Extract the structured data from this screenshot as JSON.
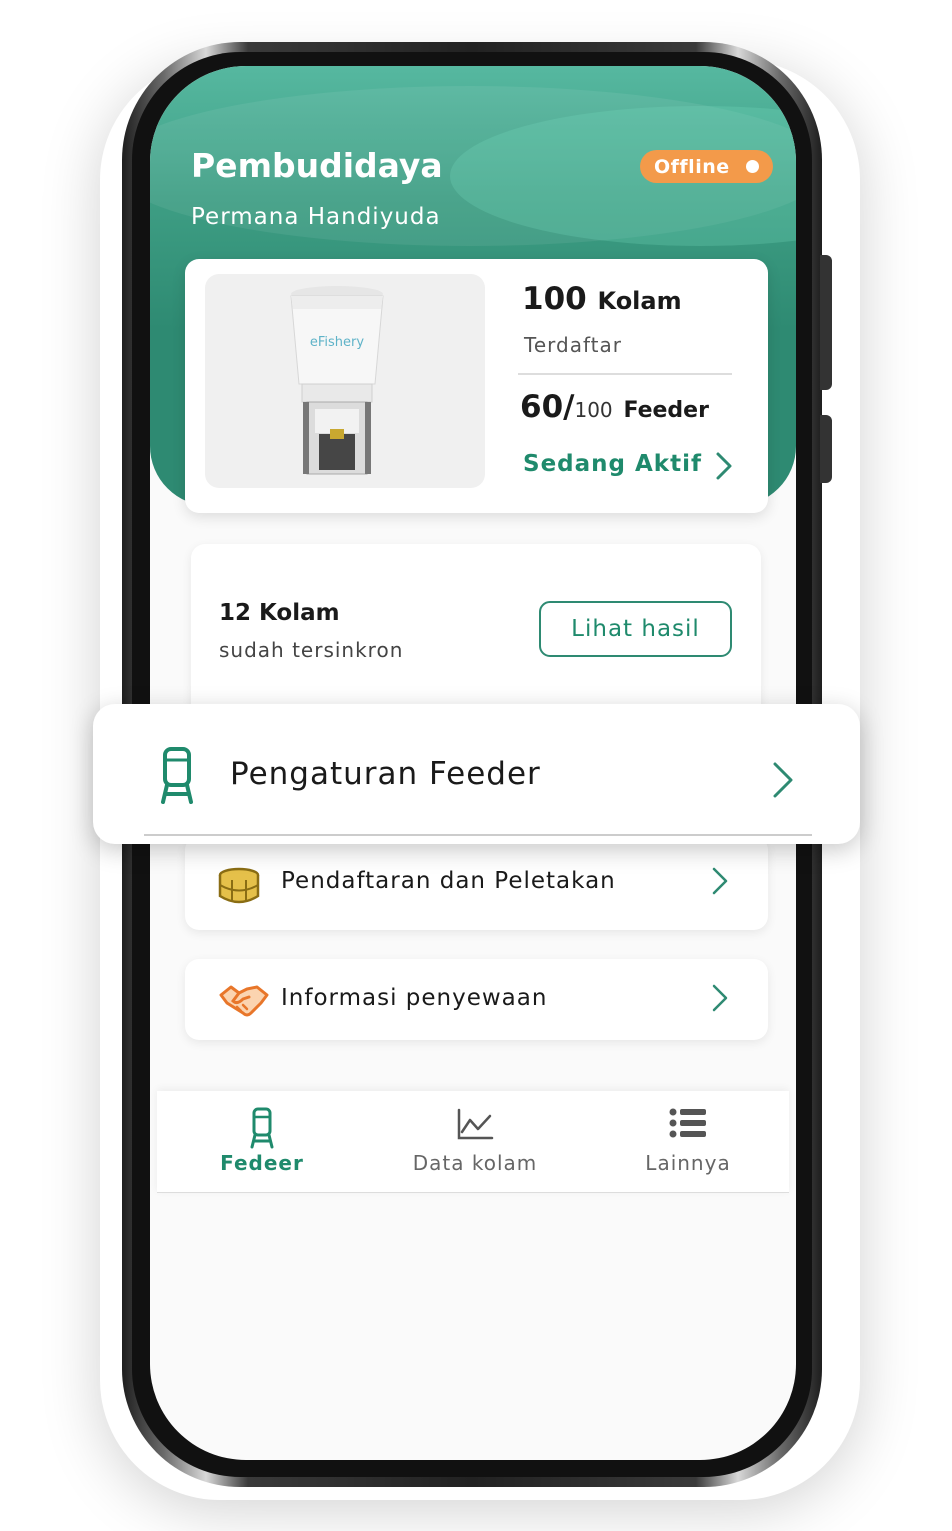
{
  "header": {
    "title": "Pembudidaya",
    "user_name": "Permana Handiyuda",
    "status_badge": "Offline"
  },
  "summary": {
    "feeder_brand": "eFishery",
    "kolam_value": "100",
    "kolam_unit": "Kolam",
    "kolam_label": "Terdaftar",
    "feeder_active": "60/",
    "feeder_total": "100",
    "feeder_unit": "Feeder",
    "active_link": "Sedang Aktif"
  },
  "sync": {
    "count": "12 Kolam",
    "label": "sudah tersinkron",
    "button": "Lihat hasil"
  },
  "menu": {
    "items": [
      {
        "label": "Pengaturan Feeder",
        "icon": "feeder-icon"
      },
      {
        "label": "Pendaftaran dan Peletakan",
        "icon": "pond-icon"
      },
      {
        "label": "Informasi penyewaan",
        "icon": "handshake-icon"
      }
    ]
  },
  "bottom_nav": {
    "tabs": [
      {
        "label": "Fedeer",
        "icon": "feeder-icon",
        "active": true
      },
      {
        "label": "Data kolam",
        "icon": "chart-line-icon",
        "active": false
      },
      {
        "label": "Lainnya",
        "icon": "list-icon",
        "active": false
      }
    ]
  },
  "colors": {
    "primary": "#2e8a72",
    "accent_orange": "#f39a4a",
    "pond_gold": "#c9a227"
  }
}
